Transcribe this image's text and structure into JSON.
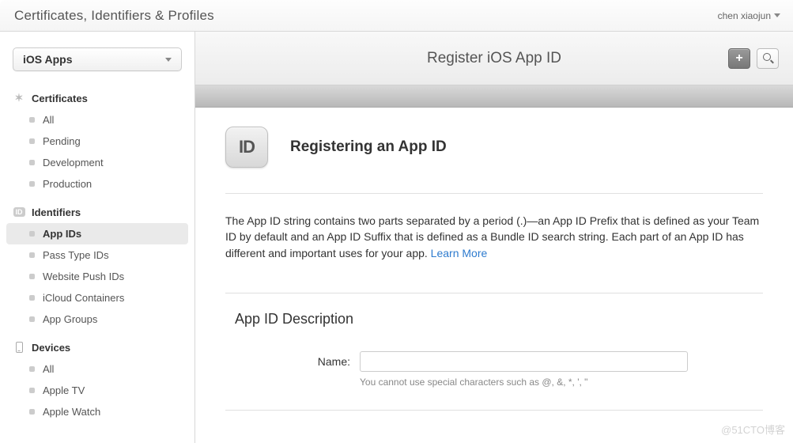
{
  "header": {
    "title": "Certificates, Identifiers & Profiles",
    "user": "chen xiaojun"
  },
  "sidebar": {
    "platform_label": "iOS Apps",
    "sections": [
      {
        "label": "Certificates",
        "items": [
          {
            "label": "All"
          },
          {
            "label": "Pending"
          },
          {
            "label": "Development"
          },
          {
            "label": "Production"
          }
        ]
      },
      {
        "label": "Identifiers",
        "items": [
          {
            "label": "App IDs"
          },
          {
            "label": "Pass Type IDs"
          },
          {
            "label": "Website Push IDs"
          },
          {
            "label": "iCloud Containers"
          },
          {
            "label": "App Groups"
          }
        ]
      },
      {
        "label": "Devices",
        "items": [
          {
            "label": "All"
          },
          {
            "label": "Apple TV"
          },
          {
            "label": "Apple Watch"
          }
        ]
      }
    ]
  },
  "main": {
    "page_title": "Register iOS App ID",
    "tile_text": "ID",
    "content_title": "Registering an App ID",
    "description_prefix": "The App ID string contains two parts separated by a period (.)—an App ID Prefix that is defined as your Team ID by default and an App ID Suffix that is defined as a Bundle ID search string. Each part of an App ID has different and important uses for your app. ",
    "learn_more": "Learn More",
    "form": {
      "section_heading": "App ID Description",
      "name_label": "Name:",
      "name_value": "",
      "name_hint": "You cannot use special characters such as @, &, *, ', \""
    }
  },
  "watermark": "@51CTO博客"
}
